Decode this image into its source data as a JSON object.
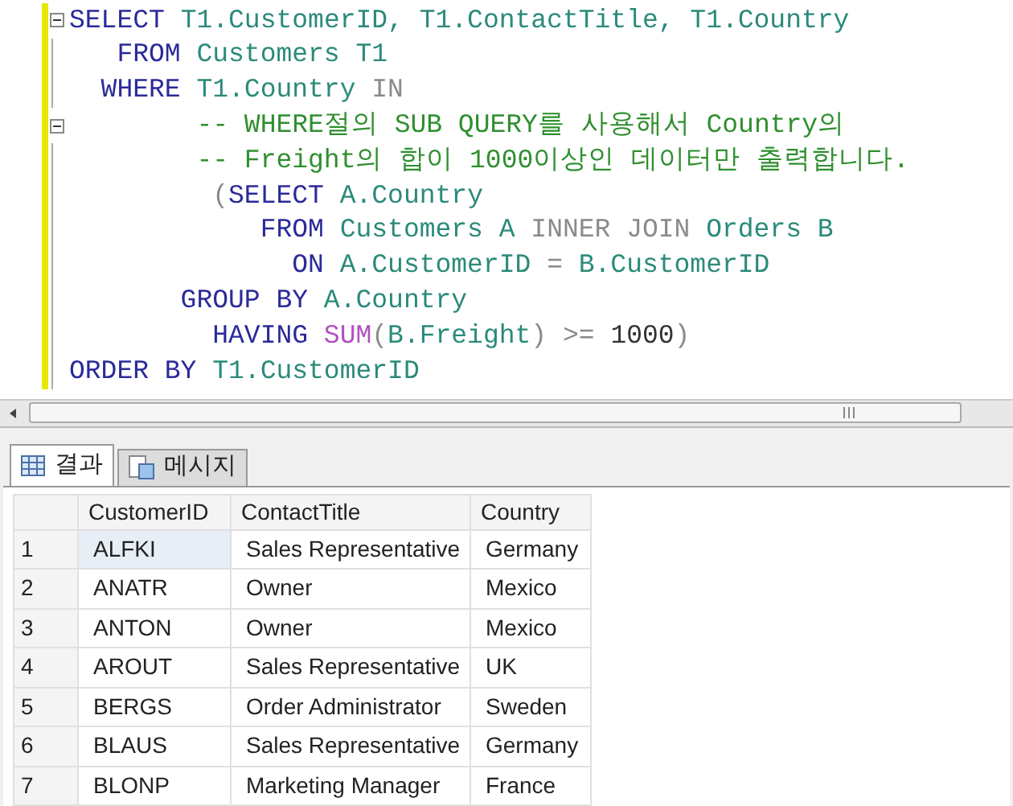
{
  "editor": {
    "lines": [
      {
        "collapsible": true,
        "changed": true,
        "tokens": [
          {
            "kind": "keyword",
            "text": "SELECT"
          },
          {
            "kind": "ident",
            "text": " T1.CustomerID, T1.ContactTitle, T1.Country"
          }
        ]
      },
      {
        "collapsible": false,
        "changed": true,
        "tokens": [
          {
            "kind": "keyword",
            "text": "   FROM"
          },
          {
            "kind": "ident",
            "text": " Customers T1"
          }
        ]
      },
      {
        "collapsible": false,
        "changed": true,
        "tokens": [
          {
            "kind": "keyword",
            "text": "  WHERE"
          },
          {
            "kind": "ident",
            "text": " T1.Country "
          },
          {
            "kind": "gray",
            "text": "IN"
          }
        ]
      },
      {
        "collapsible": true,
        "changed": true,
        "tokens": [
          {
            "kind": "comment",
            "text": "        -- WHERE절의 SUB QUERY를 사용해서 Country의"
          }
        ]
      },
      {
        "collapsible": false,
        "changed": true,
        "tokens": [
          {
            "kind": "comment",
            "text": "        -- Freight의 합이 1000이상인 데이터만 출력합니다."
          }
        ]
      },
      {
        "collapsible": false,
        "changed": true,
        "tokens": [
          {
            "kind": "gray",
            "text": "         ("
          },
          {
            "kind": "keyword",
            "text": "SELECT"
          },
          {
            "kind": "ident",
            "text": " A.Country"
          }
        ]
      },
      {
        "collapsible": false,
        "changed": true,
        "tokens": [
          {
            "kind": "keyword",
            "text": "            FROM"
          },
          {
            "kind": "ident",
            "text": " Customers A "
          },
          {
            "kind": "gray",
            "text": "INNER JOIN"
          },
          {
            "kind": "ident",
            "text": " Orders B"
          }
        ]
      },
      {
        "collapsible": false,
        "changed": true,
        "tokens": [
          {
            "kind": "keyword",
            "text": "              ON"
          },
          {
            "kind": "ident",
            "text": " A.CustomerID "
          },
          {
            "kind": "gray",
            "text": "="
          },
          {
            "kind": "ident",
            "text": " B.CustomerID"
          }
        ]
      },
      {
        "collapsible": false,
        "changed": true,
        "tokens": [
          {
            "kind": "keyword",
            "text": "       GROUP BY"
          },
          {
            "kind": "ident",
            "text": " A.Country"
          }
        ]
      },
      {
        "collapsible": false,
        "changed": true,
        "tokens": [
          {
            "kind": "keyword",
            "text": "         HAVING"
          },
          {
            "kind": "func",
            "text": " SUM"
          },
          {
            "kind": "gray",
            "text": "("
          },
          {
            "kind": "ident",
            "text": "B.Freight"
          },
          {
            "kind": "gray",
            "text": ") >= "
          },
          {
            "kind": "number",
            "text": "1000"
          },
          {
            "kind": "gray",
            "text": ")"
          }
        ]
      },
      {
        "collapsible": false,
        "changed": true,
        "tokens": [
          {
            "kind": "keyword",
            "text": "ORDER BY"
          },
          {
            "kind": "ident",
            "text": " T1.CustomerID"
          }
        ]
      }
    ]
  },
  "tabs": [
    {
      "label": "결과",
      "kind": "grid",
      "selected": true
    },
    {
      "label": "메시지",
      "kind": "messages",
      "selected": false
    }
  ],
  "table": {
    "columns": [
      "CustomerID",
      "ContactTitle",
      "Country"
    ],
    "rows": [
      {
        "number": "1",
        "cells": [
          "ALFKI",
          "Sales Representative",
          "Germany"
        ],
        "focused": true
      },
      {
        "number": "2",
        "cells": [
          "ANATR",
          "Owner",
          "Mexico"
        ],
        "focused": false
      },
      {
        "number": "3",
        "cells": [
          "ANTON",
          "Owner",
          "Mexico"
        ],
        "focused": false
      },
      {
        "number": "4",
        "cells": [
          "AROUT",
          "Sales Representative",
          "UK"
        ],
        "focused": false
      },
      {
        "number": "5",
        "cells": [
          "BERGS",
          "Order Administrator",
          "Sweden"
        ],
        "focused": false
      },
      {
        "number": "6",
        "cells": [
          "BLAUS",
          "Sales Representative",
          "Germany"
        ],
        "focused": false
      },
      {
        "number": "7",
        "cells": [
          "BLONP",
          "Marketing Manager",
          "France"
        ],
        "focused": false
      }
    ]
  }
}
